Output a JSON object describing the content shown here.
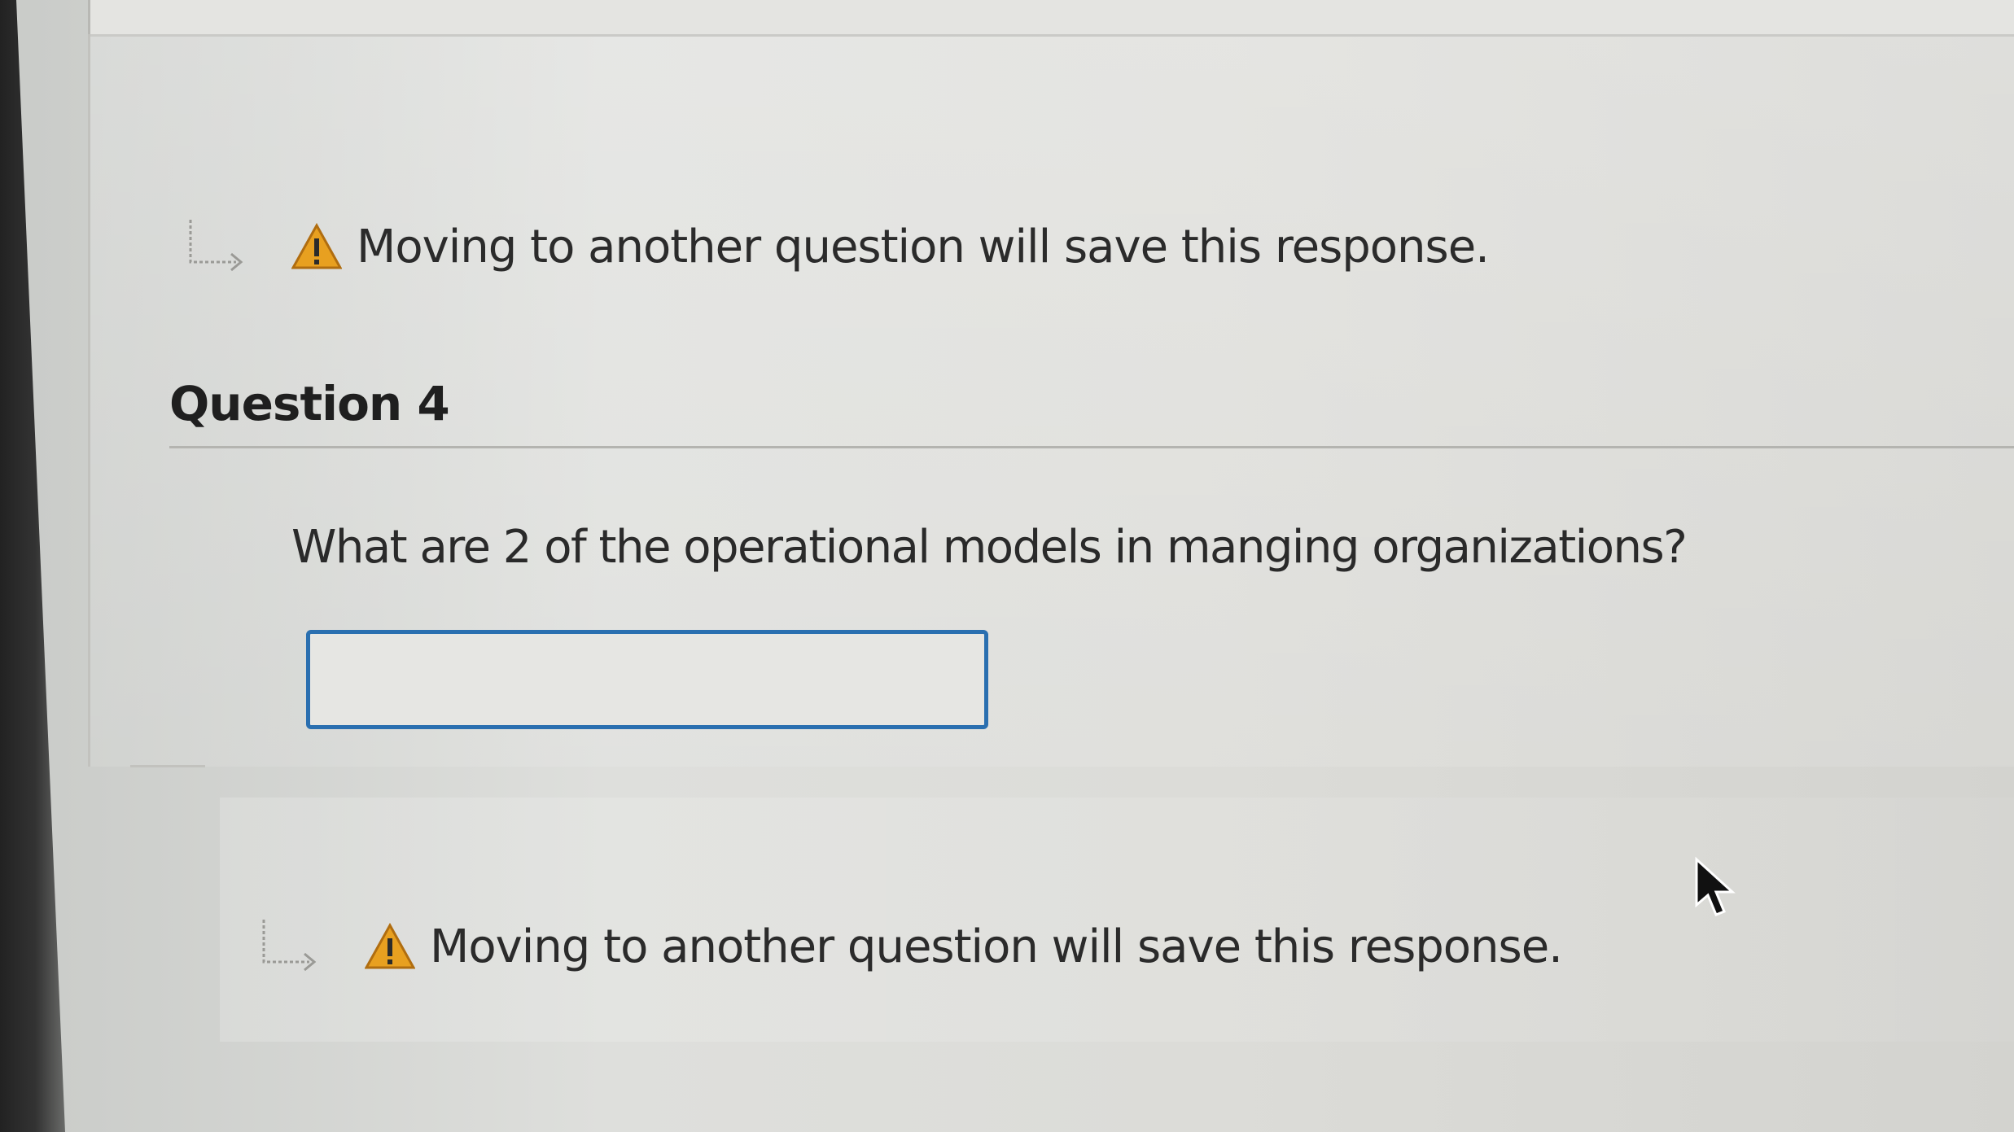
{
  "save_notice": {
    "top_text": "Moving to another question will save this response.",
    "bottom_text": "Moving to another question will save this response.",
    "icon": "warning-triangle-icon",
    "arrow_icon": "indent-arrow-icon"
  },
  "question": {
    "title": "Question 4",
    "prompt": "What are 2 of the operational models in manging organizations?",
    "answer_value": ""
  },
  "colors": {
    "input_border": "#2a6fb0",
    "warning": "#e8a020"
  }
}
